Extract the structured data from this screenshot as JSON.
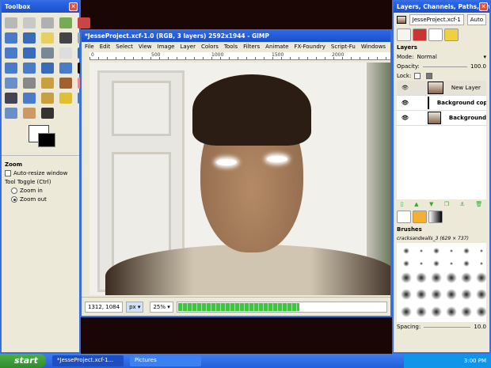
{
  "toolbox": {
    "title": "Toolbox",
    "options_title": "Zoom",
    "auto_resize": "Auto-resize window",
    "toggle_label": "Tool Toggle  (Ctrl)",
    "zoom_in": "Zoom in",
    "zoom_out": "Zoom out",
    "selected_option": "Zoom out",
    "fg_color": "#ffffff",
    "bg_color": "#000000"
  },
  "image_window": {
    "title": "*JesseProject.xcf-1.0 (RGB, 3 layers) 2592x1944 - GIMP",
    "menu": [
      "File",
      "Edit",
      "Select",
      "View",
      "Image",
      "Layer",
      "Colors",
      "Tools",
      "Filters",
      "Animate",
      "FX-Foundry",
      "Script-Fu",
      "Windows",
      "Help"
    ],
    "ruler_ticks": [
      "0",
      "500",
      "1000",
      "1500",
      "2000"
    ],
    "coords": "1312, 1084",
    "unit": "px",
    "zoom": "25%",
    "progress": 0.58
  },
  "layers_dock": {
    "title": "Layers, Channels, Paths, Undo",
    "image_select": "JesseProject.xcf-1",
    "auto": "Auto",
    "section": "Layers",
    "mode_label": "Mode:",
    "mode": "Normal",
    "opacity_label": "Opacity:",
    "opacity": "100.0",
    "lock_label": "Lock:",
    "layers": [
      {
        "name": "New Layer"
      },
      {
        "name": "Background copy"
      },
      {
        "name": "Background"
      }
    ],
    "brushes_title": "Brushes",
    "brush_name": "cracksandwalls_3 (629 × 737)",
    "spacing_label": "Spacing:",
    "spacing": "10.0"
  },
  "taskbar": {
    "start": "start",
    "tasks": [
      "*JesseProject.xcf-1...",
      "Pictures"
    ],
    "clock": "3:00 PM"
  }
}
